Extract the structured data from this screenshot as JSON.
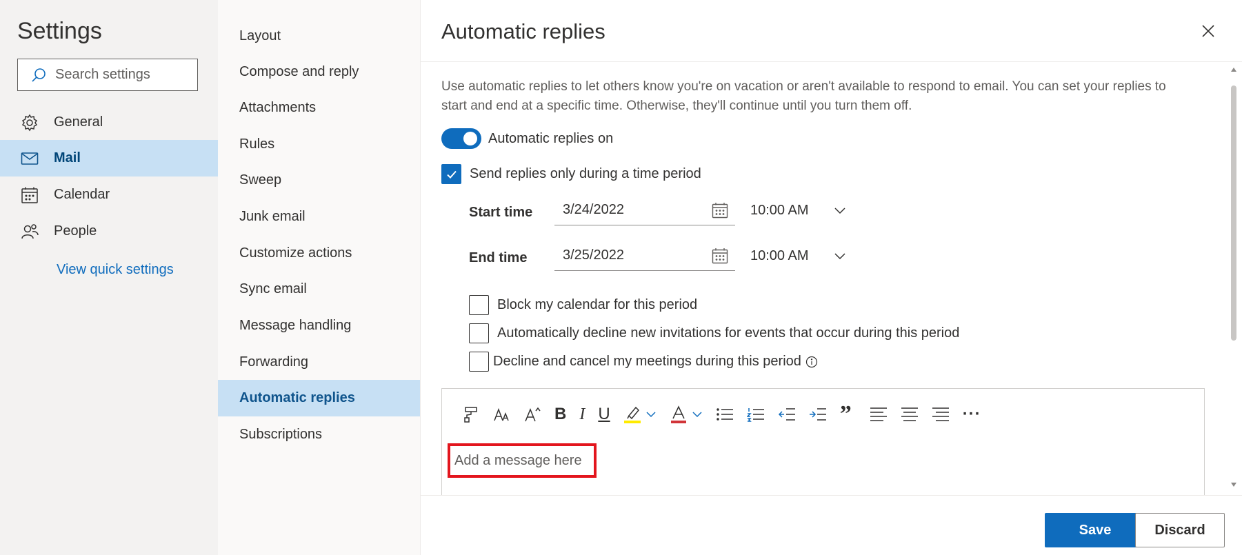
{
  "settings": {
    "title": "Settings",
    "search_placeholder": "Search settings",
    "nav": [
      {
        "label": "General",
        "icon": "gear-icon"
      },
      {
        "label": "Mail",
        "icon": "mail-icon"
      },
      {
        "label": "Calendar",
        "icon": "calendar-icon"
      },
      {
        "label": "People",
        "icon": "people-icon"
      }
    ],
    "active_nav": "Mail",
    "quick_settings_link": "View quick settings"
  },
  "subnav": {
    "items": [
      "Layout",
      "Compose and reply",
      "Attachments",
      "Rules",
      "Sweep",
      "Junk email",
      "Customize actions",
      "Sync email",
      "Message handling",
      "Forwarding",
      "Automatic replies",
      "Subscriptions"
    ],
    "active": "Automatic replies"
  },
  "panel": {
    "title": "Automatic replies",
    "description": "Use automatic replies to let others know you're on vacation or aren't available to respond to email. You can set your replies to start and end at a specific time. Otherwise, they'll continue until you turn them off.",
    "toggle": {
      "label": "Automatic replies on",
      "on": true
    },
    "time_period": {
      "label": "Send replies only during a time period",
      "checked": true
    },
    "start": {
      "label": "Start time",
      "date": "3/24/2022",
      "time": "10:00 AM"
    },
    "end": {
      "label": "End time",
      "date": "3/25/2022",
      "time": "10:00 AM"
    },
    "options": [
      {
        "label": "Block my calendar for this period",
        "checked": false
      },
      {
        "label": "Automatically decline new invitations for events that occur during this period",
        "checked": false
      },
      {
        "label": "Decline and cancel my meetings during this period",
        "checked": false
      }
    ],
    "editor": {
      "placeholder": "Add a message here",
      "toolbar": [
        "format-painter-icon",
        "font-icon",
        "font-size-icon",
        "bold-icon",
        "italic-icon",
        "underline-icon",
        "highlight-icon",
        "font-color-icon",
        "bullets-icon",
        "numbering-icon",
        "decrease-indent-icon",
        "increase-indent-icon",
        "quote-icon",
        "align-left-icon",
        "align-center-icon",
        "align-right-icon",
        "more-options-icon"
      ],
      "glyphs": {
        "bold": "B",
        "italic": "I",
        "underline": "U",
        "font_color": "A",
        "quote": "”",
        "more": "···"
      }
    },
    "buttons": {
      "save": "Save",
      "discard": "Discard"
    },
    "colors": {
      "accent": "#0f6cbd",
      "selection": "#c7e0f4",
      "highlight_box": "#e3151d"
    }
  }
}
